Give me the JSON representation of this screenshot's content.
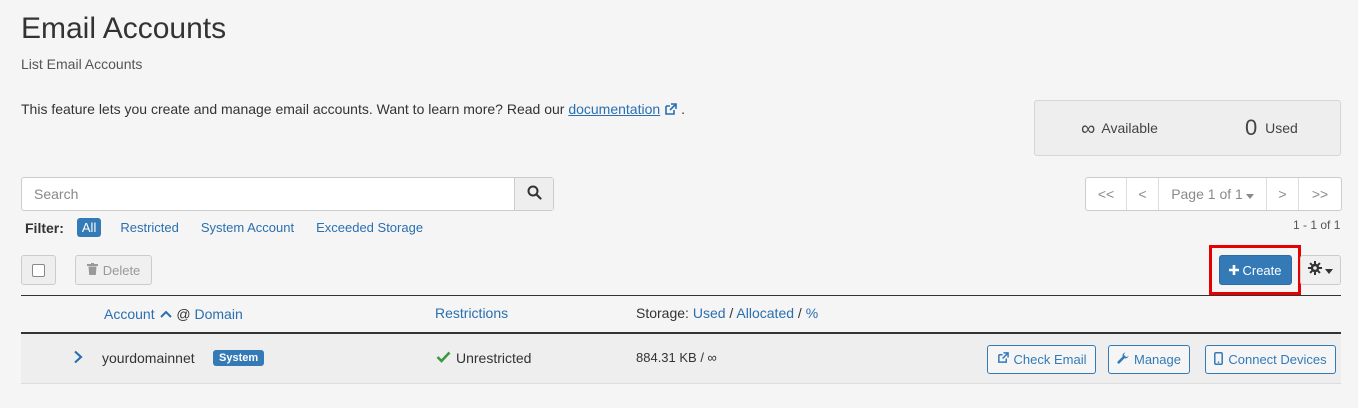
{
  "header": {
    "title": "Email Accounts",
    "subtitle": "List Email Accounts",
    "intro_text": "This feature lets you create and manage email accounts. Want to learn more? Read our ",
    "intro_link": "documentation",
    "intro_end": "."
  },
  "stats": {
    "available_symbol": "∞",
    "available_label": "Available",
    "used_count": "0",
    "used_label": "Used"
  },
  "search": {
    "placeholder": "Search"
  },
  "pagination": {
    "first": "<<",
    "prev": "<",
    "page_label": "Page 1 of 1",
    "next": ">",
    "last": ">>",
    "range": "1 - 1 of 1"
  },
  "filter": {
    "label": "Filter:",
    "options": [
      "All",
      "Restricted",
      "System Account",
      "Exceeded Storage"
    ],
    "active": "All"
  },
  "toolbar": {
    "delete_label": "Delete",
    "create_label": "Create"
  },
  "table": {
    "columns": {
      "account": "Account",
      "at": "@",
      "domain": "Domain",
      "restrictions": "Restrictions",
      "storage_prefix": "Storage:",
      "used": "Used",
      "sep1": "/",
      "allocated": "Allocated",
      "sep2": "/",
      "percent": "%"
    },
    "rows": [
      {
        "account": "yourdomainnet",
        "badge": "System",
        "restriction": "Unrestricted",
        "storage": "884.31 KB / ∞",
        "actions": [
          "Check Email",
          "Manage",
          "Connect Devices"
        ]
      }
    ]
  },
  "colors": {
    "primary": "#337ab7",
    "link": "#2a6fb0",
    "highlight": "#e60000",
    "success": "#3c9a3c"
  }
}
